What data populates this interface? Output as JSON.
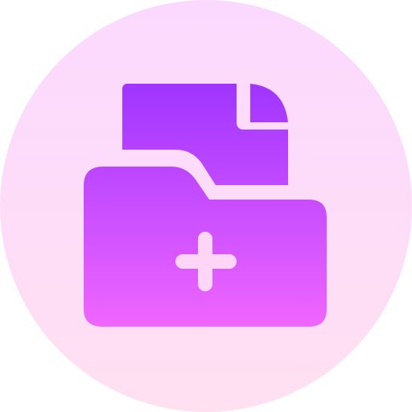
{
  "icon": {
    "name": "add-file-to-folder-icon",
    "background": {
      "shape": "circle",
      "gradient_top": "#fbd9ff",
      "gradient_bottom": "#ffe0f1"
    },
    "glyph": {
      "gradient_top": "#a035ff",
      "gradient_bottom": "#f066ff",
      "plus_color": "#fed5f4"
    }
  }
}
